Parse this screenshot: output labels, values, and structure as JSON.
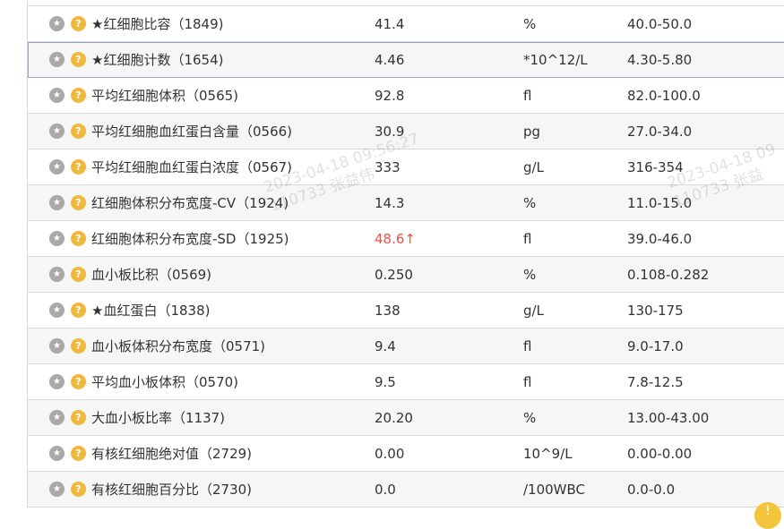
{
  "icons": {
    "star": "star-icon",
    "help": "question-icon"
  },
  "colors": {
    "abnormal": "#e8534d",
    "help_badge": "#f0b83c",
    "star_badge": "#a9a9a9"
  },
  "rows": [
    {
      "name": "★红细胞比容（1849)",
      "result": "41.4",
      "unit": "%",
      "range": "40.0-50.0"
    },
    {
      "name": "★红细胞计数（1654)",
      "result": "4.46",
      "unit": "*10^12/L",
      "range": "4.30-5.80"
    },
    {
      "name": "平均红细胞体积（0565)",
      "result": "92.8",
      "unit": "fl",
      "range": "82.0-100.0"
    },
    {
      "name": "平均红细胞血红蛋白含量（0566)",
      "result": "30.9",
      "unit": "pg",
      "range": "27.0-34.0"
    },
    {
      "name": "平均红细胞血红蛋白浓度（0567)",
      "result": "333",
      "unit": "g/L",
      "range": "316-354"
    },
    {
      "name": "红细胞体积分布宽度-CV（1924)",
      "result": "14.3",
      "unit": "%",
      "range": "11.0-15.0"
    },
    {
      "name": "红细胞体积分布宽度-SD（1925)",
      "result": "48.6↑",
      "unit": "fl",
      "range": "39.0-46.0"
    },
    {
      "name": "血小板比积（0569)",
      "result": "0.250",
      "unit": "%",
      "range": "0.108-0.282"
    },
    {
      "name": "★血红蛋白（1838)",
      "result": "138",
      "unit": "g/L",
      "range": "130-175"
    },
    {
      "name": "血小板体积分布宽度（0571)",
      "result": "9.4",
      "unit": "fl",
      "range": "9.0-17.0"
    },
    {
      "name": "平均血小板体积（0570)",
      "result": "9.5",
      "unit": "fl",
      "range": "7.8-12.5"
    },
    {
      "name": "大血小板比率（1137)",
      "result": "20.20",
      "unit": "%",
      "range": "13.00-43.00"
    },
    {
      "name": "有核红细胞绝对值（2729)",
      "result": "0.00",
      "unit": "10^9/L",
      "range": "0.00-0.00"
    },
    {
      "name": "有核红细胞百分比（2730)",
      "result": "0.0",
      "unit": "/100WBC",
      "range": "0.0-0.0"
    }
  ],
  "watermark": {
    "line1": "2023-04-18 09:56:27",
    "line2": "110733 张益伟",
    "line1_partial": "2023-04-18 09",
    "line2_partial": "110733 张益"
  }
}
